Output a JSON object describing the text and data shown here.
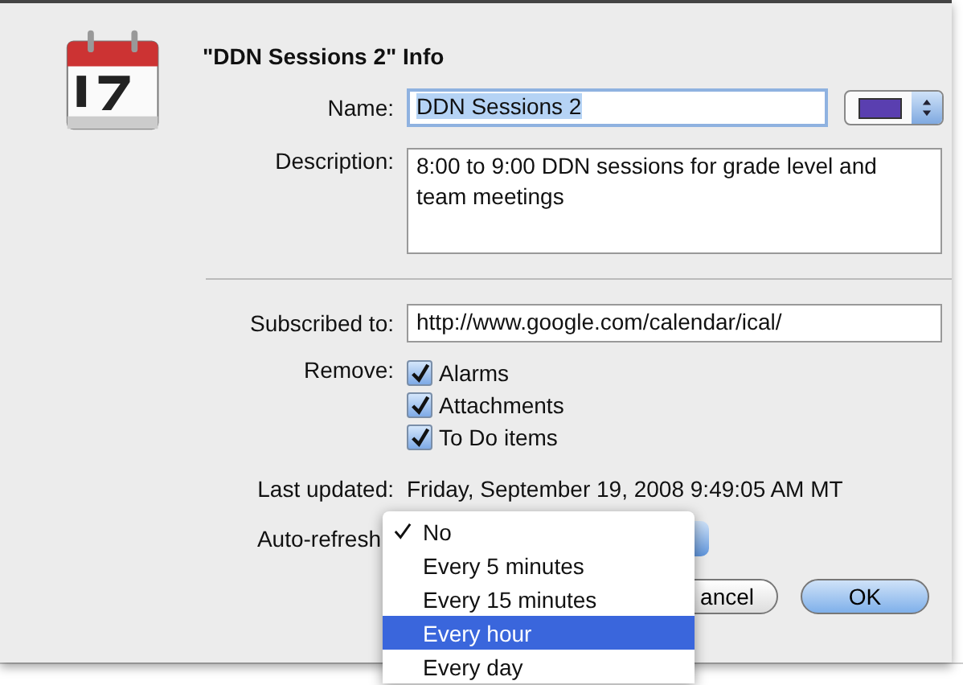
{
  "sheet": {
    "title": "\"DDN Sessions 2\" Info"
  },
  "name": {
    "label": "Name:",
    "value": "DDN Sessions 2",
    "color": "#5a3fb0"
  },
  "description": {
    "label": "Description:",
    "value": "8:00 to 9:00 DDN sessions for grade level and team meetings"
  },
  "subscribed": {
    "label": "Subscribed to:",
    "value": "http://www.google.com/calendar/ical/"
  },
  "remove": {
    "label": "Remove:",
    "options": [
      {
        "label": "Alarms",
        "checked": true
      },
      {
        "label": "Attachments",
        "checked": true
      },
      {
        "label": "To Do items",
        "checked": true
      }
    ]
  },
  "last_updated": {
    "label": "Last updated:",
    "value": "Friday, September 19, 2008 9:49:05 AM MT"
  },
  "auto_refresh": {
    "label": "Auto-refresh",
    "menu": [
      {
        "label": "No",
        "checked": true,
        "highlighted": false
      },
      {
        "label": "Every 5 minutes",
        "checked": false,
        "highlighted": false
      },
      {
        "label": "Every 15 minutes",
        "checked": false,
        "highlighted": false
      },
      {
        "label": "Every hour",
        "checked": false,
        "highlighted": true
      },
      {
        "label": "Every day",
        "checked": false,
        "highlighted": false
      }
    ]
  },
  "buttons": [
    {
      "label": "ancel",
      "kind": "cancel"
    },
    {
      "label": "OK",
      "kind": "default"
    }
  ]
}
